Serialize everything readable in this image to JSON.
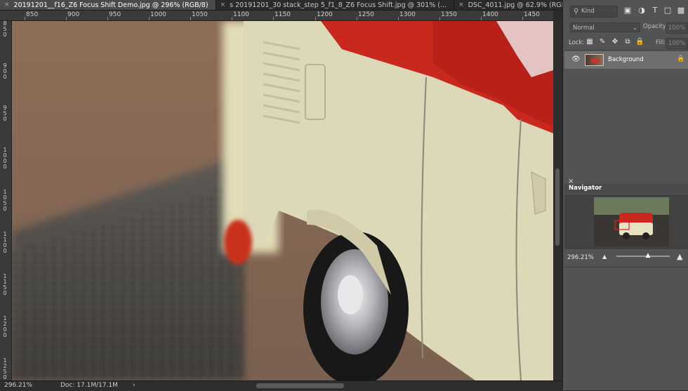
{
  "tabs": [
    {
      "label": "20191201__f16_Z6 Focus Shift Demo.jpg @ 296% (RGB/8)",
      "active": true
    },
    {
      "label": "s 20191201_30 stack_step 5_f1_8_Z6 Focus Shift.jpg @ 301% (...",
      "active": false
    },
    {
      "label": "DSC_4011.jpg @ 62.9% (RGB...",
      "active": false
    }
  ],
  "close_glyph": "×",
  "ruler_h": [
    "850",
    "900",
    "950",
    "1000",
    "1050",
    "1100",
    "1150",
    "1200",
    "1250",
    "1300",
    "1350",
    "1400",
    "1450"
  ],
  "ruler_v": [
    "850",
    "900",
    "950",
    "1000",
    "1050",
    "1100",
    "1150",
    "1200",
    "1250"
  ],
  "status": {
    "zoom": "296.21%",
    "doc": "Doc: 17.1M/17.1M",
    "arrow": "›"
  },
  "layers_panel": {
    "search_placeholder": "Kind",
    "blend_mode": "Normal",
    "opacity_label": "Opacity:",
    "opacity_value": "100%",
    "lock_label": "Lock:",
    "fill_label": "Fill:",
    "fill_value": "100%",
    "layer_name": "Background"
  },
  "navigator": {
    "title": "Navigator",
    "zoom": "296.21%"
  },
  "colors": {
    "accent_red": "#c83428",
    "van_cream": "#ddd8b8",
    "panel_bg": "#535353"
  }
}
